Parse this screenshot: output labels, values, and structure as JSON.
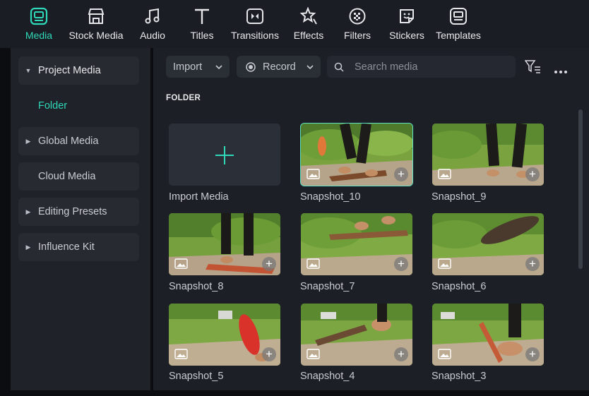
{
  "toolbar": {
    "tabs": [
      {
        "label": "Media",
        "icon": "media-icon",
        "active": true
      },
      {
        "label": "Stock Media",
        "icon": "store-icon"
      },
      {
        "label": "Audio",
        "icon": "music-note-icon"
      },
      {
        "label": "Titles",
        "icon": "text-t-icon"
      },
      {
        "label": "Transitions",
        "icon": "transition-icon"
      },
      {
        "label": "Effects",
        "icon": "effects-icon"
      },
      {
        "label": "Filters",
        "icon": "filter-icon"
      },
      {
        "label": "Stickers",
        "icon": "sticker-icon"
      },
      {
        "label": "Templates",
        "icon": "template-icon"
      }
    ],
    "accent_color": "#2fd8b9"
  },
  "sidebar": {
    "items": [
      {
        "label": "Project Media",
        "expanded": true
      },
      {
        "label": "Folder"
      },
      {
        "label": "Global Media"
      },
      {
        "label": "Cloud Media"
      },
      {
        "label": "Editing Presets"
      },
      {
        "label": "Influence Kit"
      }
    ]
  },
  "main": {
    "import_label": "Import",
    "record_label": "Record",
    "search_placeholder": "Search media",
    "folder_title": "FOLDER",
    "import_media_label": "Import Media",
    "items": [
      {
        "name": "Snapshot_10",
        "selected": true
      },
      {
        "name": "Snapshot_9"
      },
      {
        "name": "Snapshot_8"
      },
      {
        "name": "Snapshot_7"
      },
      {
        "name": "Snapshot_6"
      },
      {
        "name": "Snapshot_5"
      },
      {
        "name": "Snapshot_4"
      },
      {
        "name": "Snapshot_3"
      }
    ]
  }
}
